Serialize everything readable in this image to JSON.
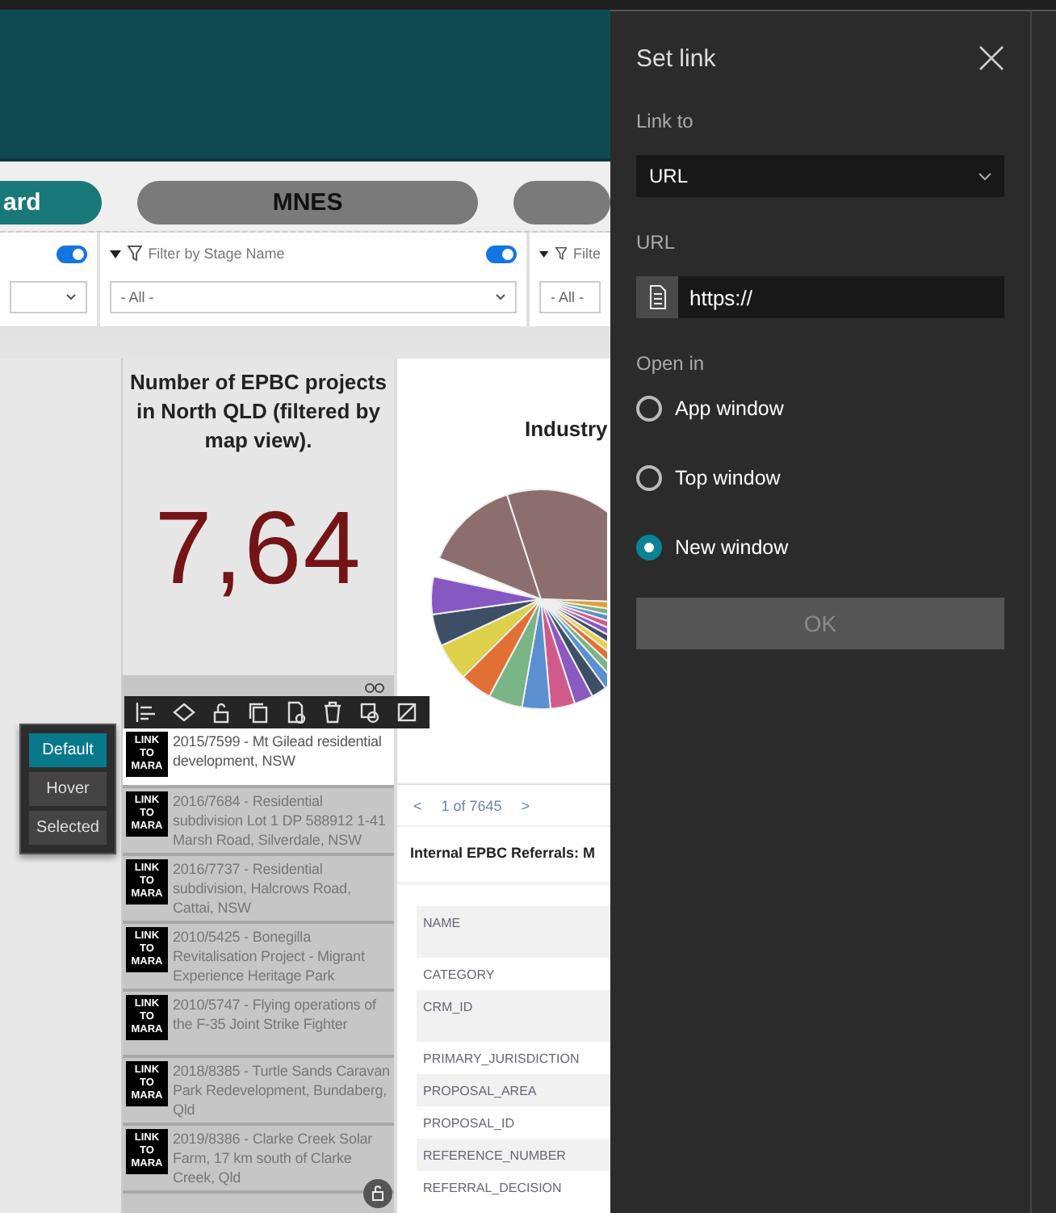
{
  "tabs": [
    {
      "label": "ard",
      "selected": true
    },
    {
      "label": "MNES",
      "selected": false
    }
  ],
  "filters": [
    {
      "toggle_on": true
    },
    {
      "label": "Filter by Stage Name",
      "toggle_on": true,
      "value": "- All -"
    },
    {
      "label": "Filte",
      "value": "- All -"
    }
  ],
  "count_card": {
    "title": "Number of EPBC projects in North QLD (filtered by map view).",
    "value": "7,64"
  },
  "style_states": [
    {
      "label": "Default",
      "selected": true
    },
    {
      "label": "Hover",
      "selected": false
    },
    {
      "label": "Selected",
      "selected": false
    }
  ],
  "project_list": [
    {
      "badge": "LINK TO MARA",
      "text": "2015/7599  - Mt Gilead residential development, NSW",
      "selected": true
    },
    {
      "badge": "LINK TO MARA",
      "text": "2016/7684  - Residential subdivision Lot 1 DP 588912 1-41 Marsh Road, Silverdale, NSW",
      "selected": false
    },
    {
      "badge": "LINK TO MARA",
      "text": "2016/7737  - Residential subdivision, Halcrows Road, Cattai, NSW",
      "selected": false
    },
    {
      "badge": "LINK TO MARA",
      "text": "2010/5425  - Bonegilla Revitalisation Project - Migrant Experience Heritage Park",
      "selected": false
    },
    {
      "badge": "LINK TO MARA",
      "text": "2010/5747  - Flying operations of the F-35 Joint Strike Fighter",
      "selected": false
    },
    {
      "badge": "LINK TO MARA",
      "text": "2018/8385  - Turtle Sands Caravan Park Redevelopment, Bundaberg, Qld",
      "selected": false
    },
    {
      "badge": "LINK TO MARA",
      "text": "2019/8386  - Clarke Creek Solar Farm, 17 km south of Clarke Creek, Qld",
      "selected": false
    }
  ],
  "chart": {
    "title": "Industry"
  },
  "pager": {
    "prev": "<",
    "text": "1 of 7645",
    "next": ">"
  },
  "details": {
    "title": "Internal EPBC Referrals: M",
    "fields": [
      "NAME",
      "CATEGORY",
      "CRM_ID",
      "PRIMARY_JURISDICTION",
      "PROPOSAL_AREA",
      "PROPOSAL_ID",
      "REFERENCE_NUMBER",
      "REFERRAL_DECISION"
    ]
  },
  "dialog": {
    "title": "Set link",
    "link_to_label": "Link to",
    "link_to_value": "URL",
    "url_label": "URL",
    "url_value": "https://",
    "open_in_label": "Open in",
    "open_in_options": [
      {
        "label": "App window",
        "selected": false
      },
      {
        "label": "Top window",
        "selected": false
      },
      {
        "label": "New window",
        "selected": true
      }
    ],
    "ok_button": {
      "label": "OK",
      "disabled": true
    }
  }
}
